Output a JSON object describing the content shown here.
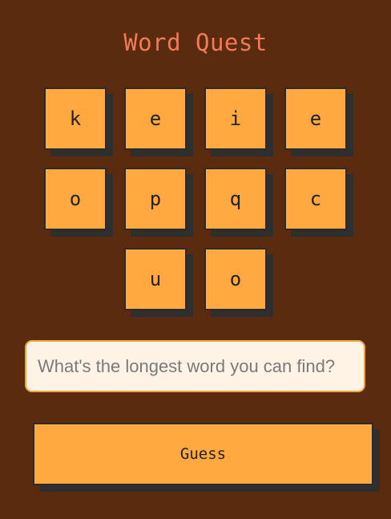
{
  "app": {
    "title": "Word Quest"
  },
  "tiles": [
    {
      "letter": "k"
    },
    {
      "letter": "e"
    },
    {
      "letter": "i"
    },
    {
      "letter": "e"
    },
    {
      "letter": "o"
    },
    {
      "letter": "p"
    },
    {
      "letter": "q"
    },
    {
      "letter": "c"
    },
    {
      "letter": "u"
    },
    {
      "letter": "o"
    }
  ],
  "input": {
    "value": "",
    "placeholder": "What's the longest word you can find?"
  },
  "guess_button": {
    "label": "Guess"
  },
  "colors": {
    "background": "#5b2b0f",
    "title": "#f07a5a",
    "tile": "#ffa940",
    "tile_shadow": "#2f2f2f",
    "input_background": "#fff3e6",
    "input_border": "#f0a640"
  }
}
